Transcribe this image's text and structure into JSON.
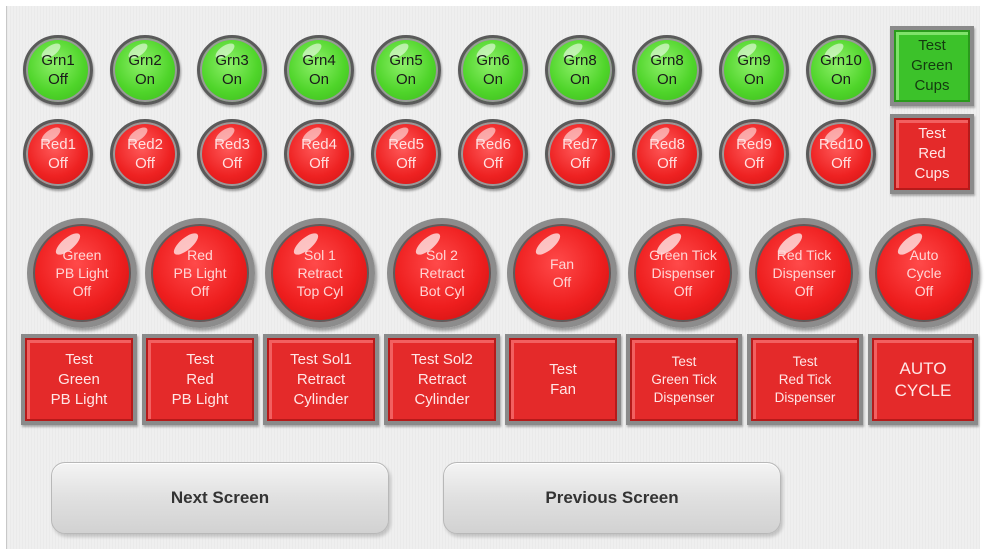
{
  "green_lamps": [
    {
      "label": "Grn1\nOff"
    },
    {
      "label": "Grn2\nOn"
    },
    {
      "label": "Grn3\nOn"
    },
    {
      "label": "Grn4\nOn"
    },
    {
      "label": "Grn5\nOn"
    },
    {
      "label": "Grn6\nOn"
    },
    {
      "label": "Grn8\nOn"
    },
    {
      "label": "Grn8\nOn"
    },
    {
      "label": "Grn9\nOn"
    },
    {
      "label": "Grn10\nOn"
    }
  ],
  "red_lamps": [
    {
      "label": "Red1\nOff"
    },
    {
      "label": "Red2\nOff"
    },
    {
      "label": "Red3\nOff"
    },
    {
      "label": "Red4\nOff"
    },
    {
      "label": "Red5\nOff"
    },
    {
      "label": "Red6\nOff"
    },
    {
      "label": "Red7\nOff"
    },
    {
      "label": "Red8\nOff"
    },
    {
      "label": "Red9\nOff"
    },
    {
      "label": "Red10\nOff"
    }
  ],
  "test_green_cups_label": "Test\nGreen\nCups",
  "test_red_cups_label": "Test\nRed\nCups",
  "pilot_lights": [
    {
      "label": "Green\nPB Light\nOff"
    },
    {
      "label": "Red\nPB Light\nOff"
    },
    {
      "label": "Sol 1\nRetract\nTop Cyl"
    },
    {
      "label": "Sol 2\nRetract\nBot Cyl"
    },
    {
      "label": "Fan\nOff"
    },
    {
      "label": "Green Tick\nDispenser\nOff"
    },
    {
      "label": "Red Tick\nDispenser\nOff"
    },
    {
      "label": "Auto\nCycle\nOff"
    }
  ],
  "test_buttons": [
    {
      "label": "Test\nGreen\nPB Light"
    },
    {
      "label": "Test\nRed\nPB Light"
    },
    {
      "label": "Test Sol1\nRetract\nCylinder"
    },
    {
      "label": "Test Sol2\nRetract\nCylinder"
    },
    {
      "label": "Test\nFan"
    },
    {
      "label": "Test\nGreen Tick\nDispenser"
    },
    {
      "label": "Test\nRed Tick\nDispenser"
    },
    {
      "label": "AUTO\nCYCLE"
    }
  ],
  "nav": {
    "next_label": "Next Screen",
    "previous_label": "Previous Screen"
  },
  "colors": {
    "lamp_green": "#4fd52a",
    "lamp_red": "#ee2222",
    "button_red": "#e42a2a",
    "button_green": "#3cc22a"
  }
}
